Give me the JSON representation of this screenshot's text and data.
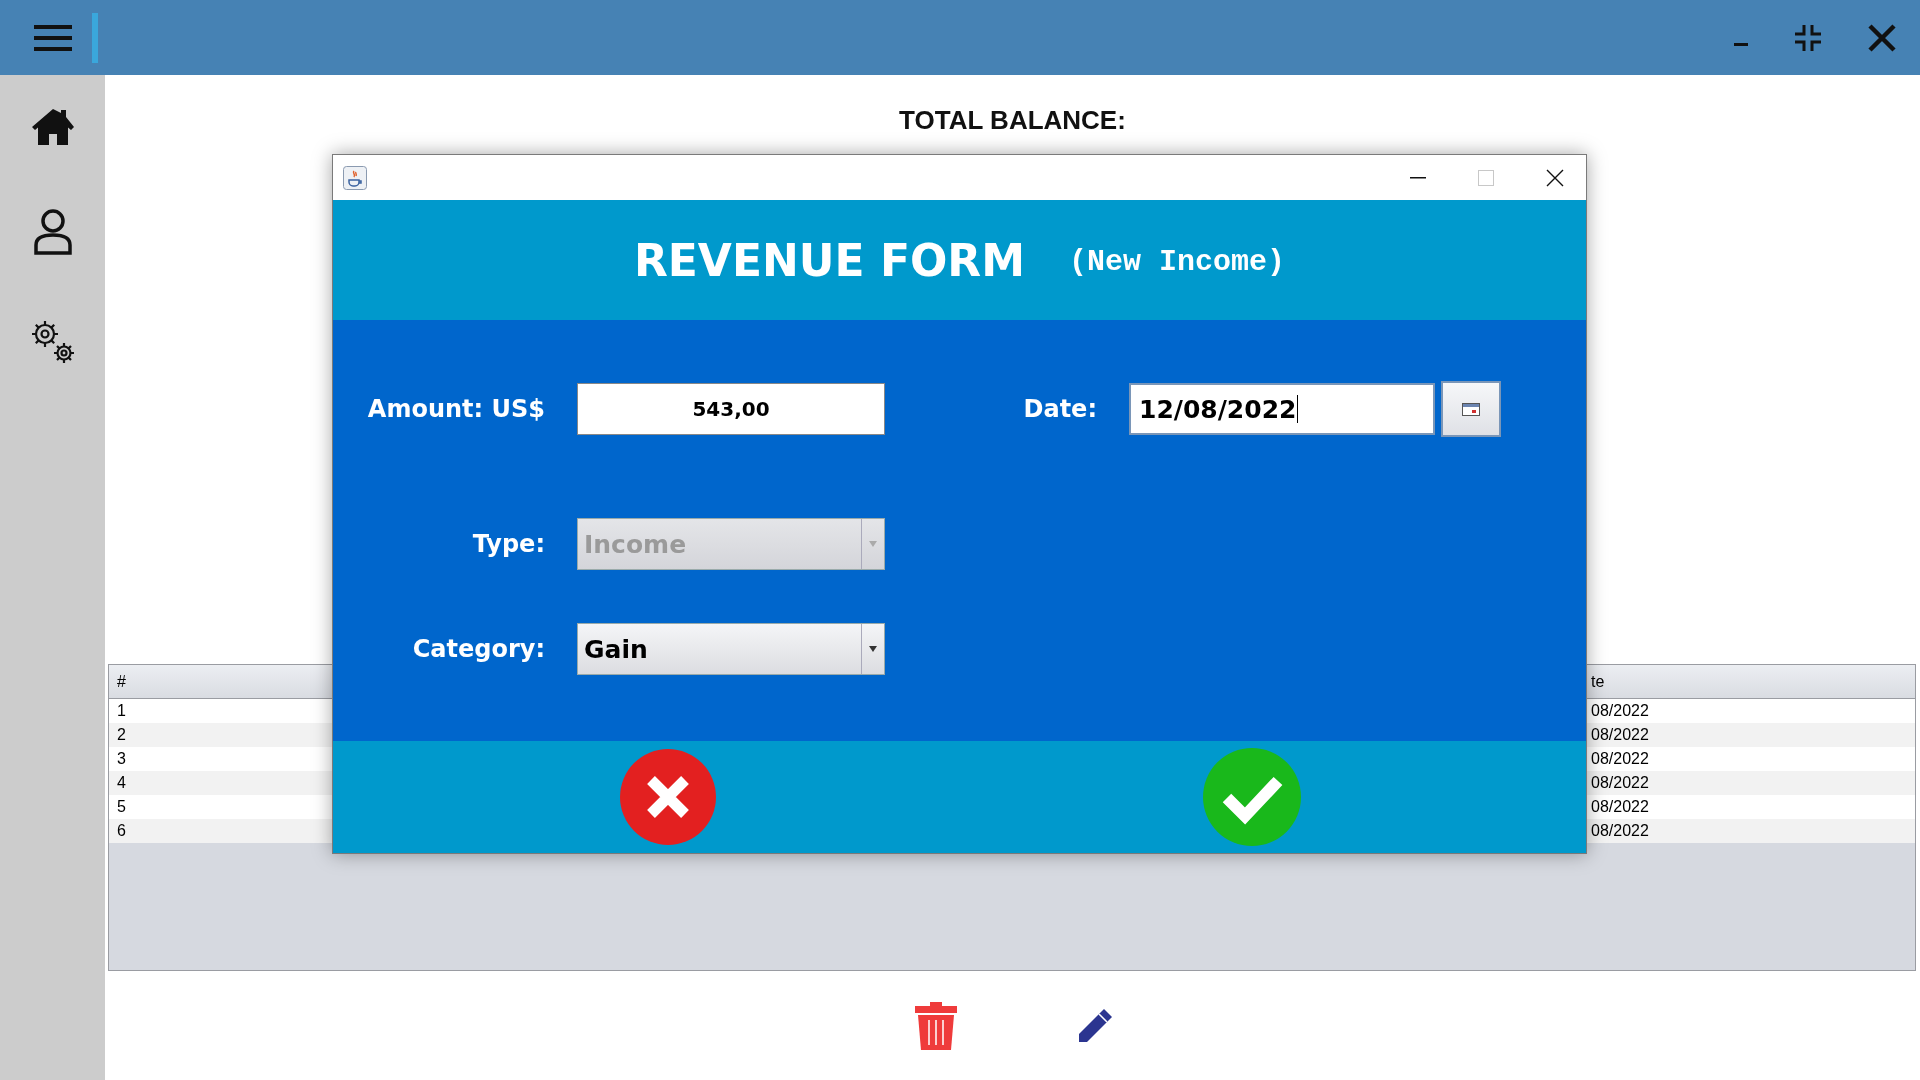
{
  "total_balance_label": "TOTAL BALANCE:",
  "table": {
    "columns": [
      "#",
      "te"
    ],
    "rows": [
      [
        "1",
        "08/2022"
      ],
      [
        "2",
        "08/2022"
      ],
      [
        "3",
        "08/2022"
      ],
      [
        "4",
        "08/2022"
      ],
      [
        "5",
        "08/2022"
      ],
      [
        "6",
        "08/2022"
      ]
    ]
  },
  "dialog": {
    "title": "REVENUE FORM",
    "subtitle": "(New Income)",
    "fields": [
      {
        "kind": "text",
        "label": "Amount: US$",
        "value": "543,00"
      },
      {
        "kind": "date",
        "label": "Date:",
        "value": "12/08/2022"
      },
      {
        "kind": "combo",
        "label": "Type:",
        "value": "Income",
        "disabled": true
      },
      {
        "kind": "combo",
        "label": "Category:",
        "value": "Gain",
        "disabled": false
      }
    ]
  }
}
